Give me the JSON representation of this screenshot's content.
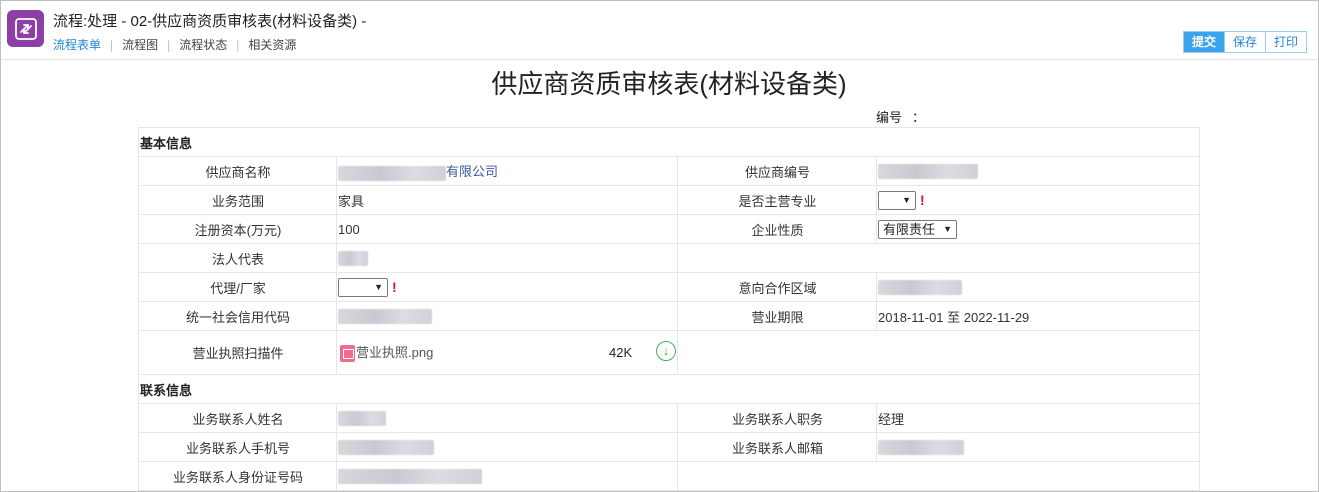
{
  "header": {
    "title": "流程:处理 - 02-供应商资质审核表(材料设备类) -",
    "tabs": [
      "流程表单",
      "流程图",
      "流程状态",
      "相关资源"
    ],
    "active_tab": "流程表单",
    "buttons": {
      "submit": "提交",
      "save": "保存",
      "print": "打印"
    },
    "colors": {
      "accent": "#1f87d6",
      "primary_button": "#3ba3ea",
      "app_icon": "#8c3fa7",
      "required": "#e0141e"
    },
    "icon": "process-icon"
  },
  "form": {
    "title": "供应商资质审核表(材料设备类)",
    "code_label": "编号",
    "code_colon": "：",
    "sections": {
      "basic": "基本信息",
      "contact": "联系信息"
    },
    "fields": {
      "supplier_name_label": "供应商名称",
      "supplier_name_value": "有限公司",
      "supplier_code_label": "供应商编号",
      "business_scope_label": "业务范围",
      "business_scope_value": "家具",
      "main_specialty_label": "是否主营专业",
      "reg_capital_label": "注册资本(万元)",
      "reg_capital_value": "100",
      "company_type_label": "企业性质",
      "company_type_value": "有限责任",
      "legal_rep_label": "法人代表",
      "agent_label": "代理/厂家",
      "region_label": "意向合作区域",
      "credit_code_label": "统一社会信用代码",
      "business_term_label": "营业期限",
      "business_term_value": "2018-11-01 至 2022-11-29",
      "license_scan_label": "营业执照扫描件",
      "license_file_name": "营业执照.png",
      "license_file_size": "42K",
      "contact_name_label": "业务联系人姓名",
      "contact_title_label": "业务联系人职务",
      "contact_title_value": "经理",
      "contact_phone_label": "业务联系人手机号",
      "contact_email_label": "业务联系人邮箱",
      "contact_id_label": "业务联系人身份证号码"
    },
    "required_mark": "!"
  }
}
